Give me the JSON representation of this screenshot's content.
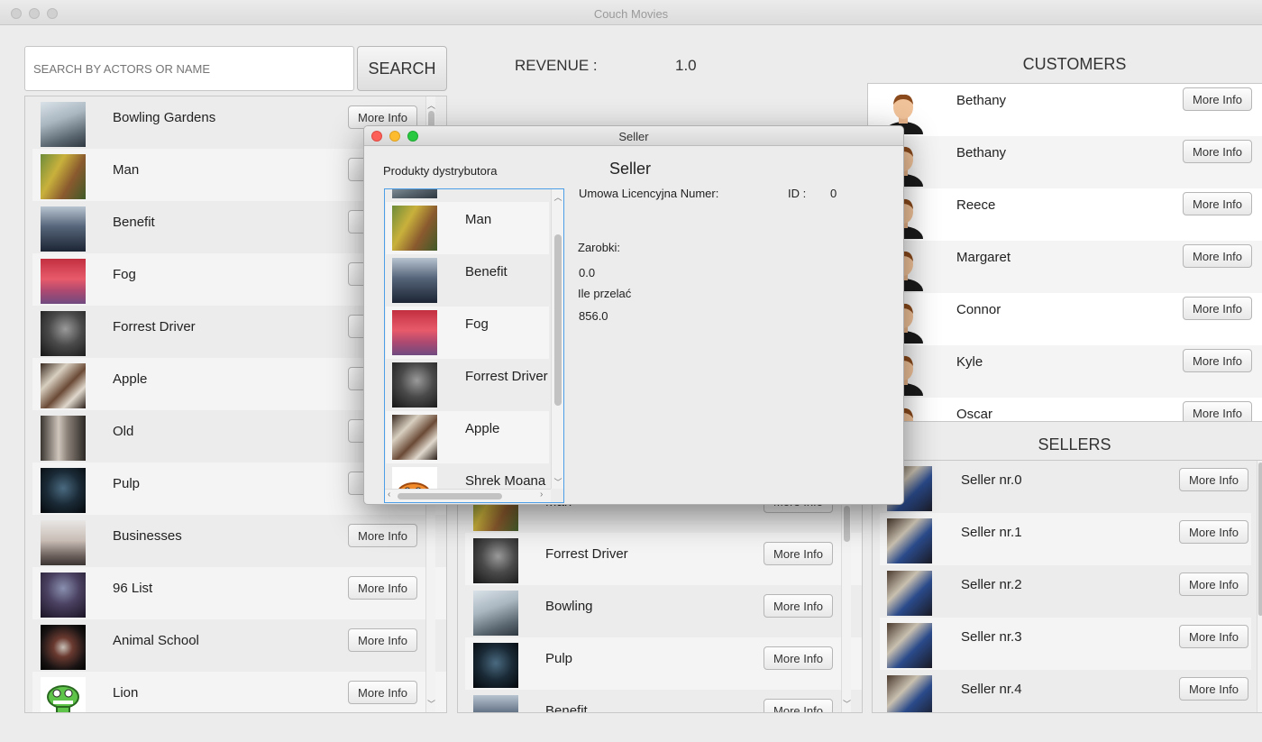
{
  "window": {
    "title": "Couch Movies"
  },
  "search": {
    "placeholder": "SEARCH BY ACTORS OR NAME",
    "button_label": "SEARCH"
  },
  "revenue": {
    "label": "REVENUE :",
    "value": "1.0"
  },
  "movies_left": {
    "items": [
      {
        "title": "Bowling Gardens",
        "button": "More Info"
      },
      {
        "title": "Man",
        "button": "M"
      },
      {
        "title": "Benefit",
        "button": "M"
      },
      {
        "title": "Fog",
        "button": "M"
      },
      {
        "title": "Forrest Driver",
        "button": "M"
      },
      {
        "title": "Apple",
        "button": "M"
      },
      {
        "title": "Old",
        "button": "M"
      },
      {
        "title": "Pulp",
        "button": "M"
      },
      {
        "title": "Businesses",
        "button": "More Info"
      },
      {
        "title": "96 List",
        "button": "More Info"
      },
      {
        "title": "Animal School",
        "button": "More Info"
      },
      {
        "title": "Lion",
        "button": "More Info"
      }
    ]
  },
  "movies_middle": {
    "items": [
      {
        "title": "Man",
        "button": "More Info"
      },
      {
        "title": "Forrest Driver",
        "button": "More Info"
      },
      {
        "title": "Bowling",
        "button": "More Info"
      },
      {
        "title": "Pulp",
        "button": "More Info"
      },
      {
        "title": "Benefit",
        "button": "More Info"
      }
    ]
  },
  "customers": {
    "title": "CUSTOMERS",
    "items": [
      {
        "name": "Bethany",
        "button": "More Info"
      },
      {
        "name": "Bethany",
        "button": "More Info"
      },
      {
        "name": "Reece",
        "button": "More Info"
      },
      {
        "name": "Margaret",
        "button": "More Info"
      },
      {
        "name": "Connor",
        "button": "More Info"
      },
      {
        "name": "Kyle",
        "button": "More Info"
      },
      {
        "name": "Oscar",
        "button": "More Info"
      }
    ]
  },
  "sellers": {
    "title": "SELLERS",
    "items": [
      {
        "name": "Seller nr.0",
        "button": "More Info"
      },
      {
        "name": "Seller nr.1",
        "button": "More Info"
      },
      {
        "name": "Seller nr.2",
        "button": "More Info"
      },
      {
        "name": "Seller nr.3",
        "button": "More Info"
      },
      {
        "name": "Seller nr.4",
        "button": "More Info"
      }
    ]
  },
  "dialog": {
    "title": "Seller",
    "products_label": "Produkty dystrybutora",
    "heading": "Seller",
    "license_label": "Umowa Licencyjna Numer:",
    "id_label": "ID :",
    "id_value": "0",
    "earnings_label": "Zarobki:",
    "earnings_value": "0.0",
    "transfer_label": "Ile przelać",
    "transfer_value": "856.0",
    "products": [
      "Man",
      "Benefit",
      "Fog",
      "Forrest Driver",
      "Apple",
      "Shrek Moana"
    ]
  }
}
